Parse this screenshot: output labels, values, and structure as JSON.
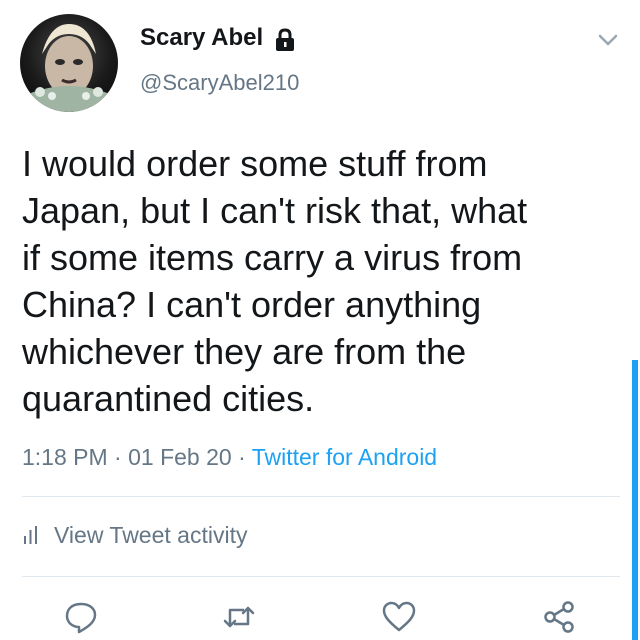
{
  "user": {
    "display_name": "Scary Abel",
    "handle": "@ScaryAbel210",
    "protected_icon": "lock-icon",
    "avatar_icon": "avatar"
  },
  "tweet": {
    "text": "I would order some stuff from\nJapan, but I can't risk that, what\nif some items carry a virus from\nChina? I can't order anything\nwhichever they are from the\nquarantined cities.",
    "time": "1:18 PM",
    "separator": " · ",
    "date": "01 Feb 20",
    "source": "Twitter for Android"
  },
  "activity": {
    "label": "View Tweet activity",
    "icon": "bar-chart-icon"
  },
  "actions": [
    {
      "name": "reply",
      "icon": "reply-icon"
    },
    {
      "name": "retweet",
      "icon": "retweet-icon"
    },
    {
      "name": "like",
      "icon": "heart-icon"
    },
    {
      "name": "share",
      "icon": "share-icon"
    }
  ],
  "menu_icon": "chevron-down-icon",
  "colors": {
    "text": "#14171a",
    "secondary": "#657786",
    "accent": "#1da1f2",
    "divider": "#e1e8ed"
  }
}
